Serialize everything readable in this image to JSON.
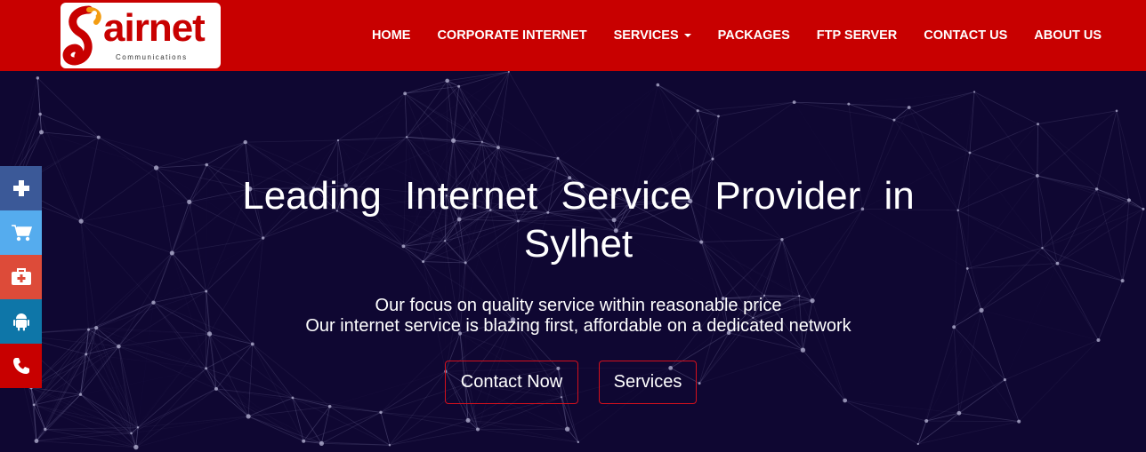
{
  "brand": {
    "name": "airnet",
    "tagline": "Communications",
    "logo_icon": "airnet-logo-icon",
    "color": "#c80000"
  },
  "nav": {
    "items": [
      {
        "label": "HOME"
      },
      {
        "label": "CORPORATE INTERNET"
      },
      {
        "label": "SERVICES"
      },
      {
        "label": "PACKAGES"
      },
      {
        "label": "FTP SERVER"
      },
      {
        "label": "CONTACT US"
      },
      {
        "label": "ABOUT US"
      }
    ]
  },
  "hero": {
    "title": "Leading Internet Service Provider in Sylhet",
    "line1": "Our focus on quality service within reasonable price",
    "line2": "Our internet service is blazing first, affordable on a dedicated network",
    "btn_contact": "Contact Now",
    "btn_services": "Services",
    "background": "#0f0732",
    "accent": "#d4101c"
  },
  "side_bar": {
    "items": [
      {
        "icon": "plus-icon",
        "color": "#3b5998"
      },
      {
        "icon": "cart-icon",
        "color": "#55acee"
      },
      {
        "icon": "medical-kit-icon",
        "color": "#dd4b39"
      },
      {
        "icon": "android-icon",
        "color": "#0e76a8"
      },
      {
        "icon": "phone-icon",
        "color": "#c80000"
      }
    ]
  }
}
